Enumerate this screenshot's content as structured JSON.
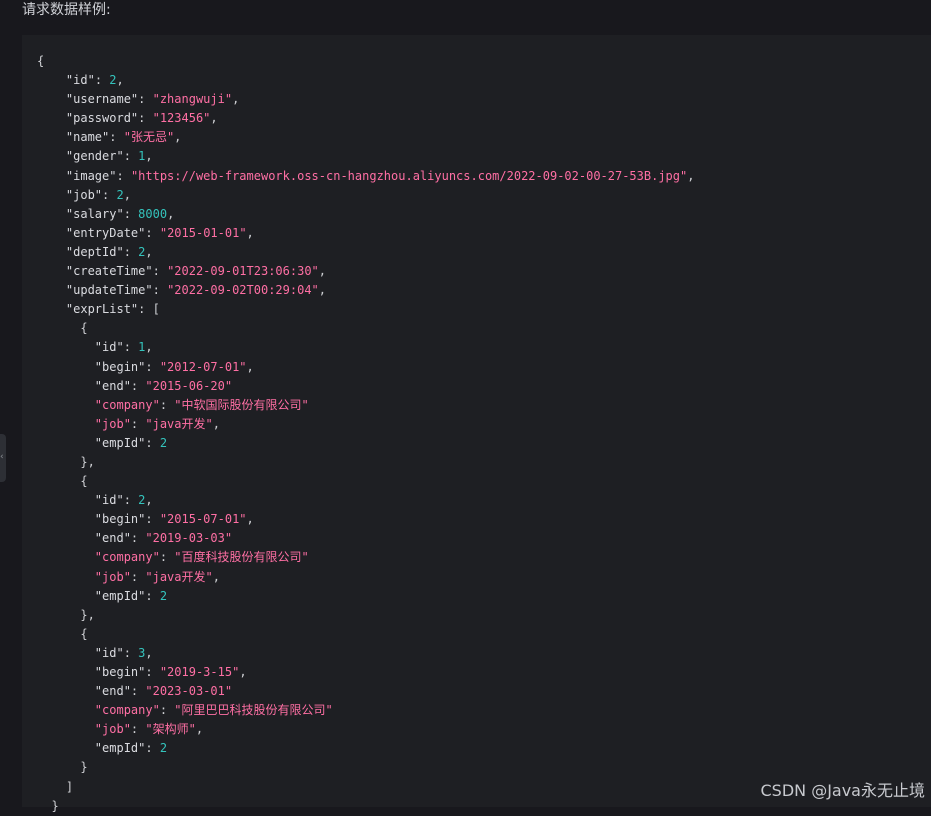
{
  "heading": "请求数据样例:",
  "watermark": "CSDN @Java永无止境",
  "code": [
    [
      {
        "t": "p",
        "v": "{"
      }
    ],
    [
      {
        "t": "p",
        "v": "    "
      },
      {
        "t": "k",
        "v": "\"id\""
      },
      {
        "t": "p",
        "v": ": "
      },
      {
        "t": "n",
        "v": "2"
      },
      {
        "t": "p",
        "v": ","
      }
    ],
    [
      {
        "t": "p",
        "v": "    "
      },
      {
        "t": "k",
        "v": "\"username\""
      },
      {
        "t": "p",
        "v": ": "
      },
      {
        "t": "s",
        "v": "\"zhangwuji\""
      },
      {
        "t": "p",
        "v": ","
      }
    ],
    [
      {
        "t": "p",
        "v": "    "
      },
      {
        "t": "k",
        "v": "\"password\""
      },
      {
        "t": "p",
        "v": ": "
      },
      {
        "t": "s",
        "v": "\"123456\""
      },
      {
        "t": "p",
        "v": ","
      }
    ],
    [
      {
        "t": "p",
        "v": "    "
      },
      {
        "t": "k",
        "v": "\"name\""
      },
      {
        "t": "p",
        "v": ": "
      },
      {
        "t": "s",
        "v": "\"张无忌\""
      },
      {
        "t": "p",
        "v": ","
      }
    ],
    [
      {
        "t": "p",
        "v": "    "
      },
      {
        "t": "k",
        "v": "\"gender\""
      },
      {
        "t": "p",
        "v": ": "
      },
      {
        "t": "n",
        "v": "1"
      },
      {
        "t": "p",
        "v": ","
      }
    ],
    [
      {
        "t": "p",
        "v": "    "
      },
      {
        "t": "k",
        "v": "\"image\""
      },
      {
        "t": "p",
        "v": ": "
      },
      {
        "t": "s",
        "v": "\"https://web-framework.oss-cn-hangzhou.aliyuncs.com/2022-09-02-00-27-53B.jpg\""
      },
      {
        "t": "p",
        "v": ","
      }
    ],
    [
      {
        "t": "p",
        "v": "    "
      },
      {
        "t": "k",
        "v": "\"job\""
      },
      {
        "t": "p",
        "v": ": "
      },
      {
        "t": "n",
        "v": "2"
      },
      {
        "t": "p",
        "v": ","
      }
    ],
    [
      {
        "t": "p",
        "v": "    "
      },
      {
        "t": "k",
        "v": "\"salary\""
      },
      {
        "t": "p",
        "v": ": "
      },
      {
        "t": "n",
        "v": "8000"
      },
      {
        "t": "p",
        "v": ","
      }
    ],
    [
      {
        "t": "p",
        "v": "    "
      },
      {
        "t": "k",
        "v": "\"entryDate\""
      },
      {
        "t": "p",
        "v": ": "
      },
      {
        "t": "s",
        "v": "\"2015-01-01\""
      },
      {
        "t": "p",
        "v": ","
      }
    ],
    [
      {
        "t": "p",
        "v": "    "
      },
      {
        "t": "k",
        "v": "\"deptId\""
      },
      {
        "t": "p",
        "v": ": "
      },
      {
        "t": "n",
        "v": "2"
      },
      {
        "t": "p",
        "v": ","
      }
    ],
    [
      {
        "t": "p",
        "v": "    "
      },
      {
        "t": "k",
        "v": "\"createTime\""
      },
      {
        "t": "p",
        "v": ": "
      },
      {
        "t": "s",
        "v": "\"2022-09-01T23:06:30\""
      },
      {
        "t": "p",
        "v": ","
      }
    ],
    [
      {
        "t": "p",
        "v": "    "
      },
      {
        "t": "k",
        "v": "\"updateTime\""
      },
      {
        "t": "p",
        "v": ": "
      },
      {
        "t": "s",
        "v": "\"2022-09-02T00:29:04\""
      },
      {
        "t": "p",
        "v": ","
      }
    ],
    [
      {
        "t": "p",
        "v": "    "
      },
      {
        "t": "k",
        "v": "\"exprList\""
      },
      {
        "t": "p",
        "v": ": ["
      }
    ],
    [
      {
        "t": "p",
        "v": "      {"
      }
    ],
    [
      {
        "t": "p",
        "v": "        "
      },
      {
        "t": "k",
        "v": "\"id\""
      },
      {
        "t": "p",
        "v": ": "
      },
      {
        "t": "n",
        "v": "1"
      },
      {
        "t": "p",
        "v": ","
      }
    ],
    [
      {
        "t": "p",
        "v": "        "
      },
      {
        "t": "k",
        "v": "\"begin\""
      },
      {
        "t": "p",
        "v": ": "
      },
      {
        "t": "s",
        "v": "\"2012-07-01\""
      },
      {
        "t": "p",
        "v": ","
      }
    ],
    [
      {
        "t": "p",
        "v": "        "
      },
      {
        "t": "k",
        "v": "\"end\""
      },
      {
        "t": "p",
        "v": ": "
      },
      {
        "t": "s",
        "v": "\"2015-06-20\""
      }
    ],
    [
      {
        "t": "p",
        "v": "        "
      },
      {
        "t": "s",
        "v": "\"company\""
      },
      {
        "t": "p",
        "v": ": "
      },
      {
        "t": "s",
        "v": "\"中软国际股份有限公司\""
      }
    ],
    [
      {
        "t": "p",
        "v": "        "
      },
      {
        "t": "s",
        "v": "\"job\""
      },
      {
        "t": "p",
        "v": ": "
      },
      {
        "t": "s",
        "v": "\"java开发\""
      },
      {
        "t": "p",
        "v": ","
      }
    ],
    [
      {
        "t": "p",
        "v": "        "
      },
      {
        "t": "k",
        "v": "\"empId\""
      },
      {
        "t": "p",
        "v": ": "
      },
      {
        "t": "n",
        "v": "2"
      }
    ],
    [
      {
        "t": "p",
        "v": "      },"
      }
    ],
    [
      {
        "t": "p",
        "v": "      {"
      }
    ],
    [
      {
        "t": "p",
        "v": "        "
      },
      {
        "t": "k",
        "v": "\"id\""
      },
      {
        "t": "p",
        "v": ": "
      },
      {
        "t": "n",
        "v": "2"
      },
      {
        "t": "p",
        "v": ","
      }
    ],
    [
      {
        "t": "p",
        "v": "        "
      },
      {
        "t": "k",
        "v": "\"begin\""
      },
      {
        "t": "p",
        "v": ": "
      },
      {
        "t": "s",
        "v": "\"2015-07-01\""
      },
      {
        "t": "p",
        "v": ","
      }
    ],
    [
      {
        "t": "p",
        "v": "        "
      },
      {
        "t": "k",
        "v": "\"end\""
      },
      {
        "t": "p",
        "v": ": "
      },
      {
        "t": "s",
        "v": "\"2019-03-03\""
      }
    ],
    [
      {
        "t": "p",
        "v": "        "
      },
      {
        "t": "s",
        "v": "\"company\""
      },
      {
        "t": "p",
        "v": ": "
      },
      {
        "t": "s",
        "v": "\"百度科技股份有限公司\""
      }
    ],
    [
      {
        "t": "p",
        "v": "        "
      },
      {
        "t": "s",
        "v": "\"job\""
      },
      {
        "t": "p",
        "v": ": "
      },
      {
        "t": "s",
        "v": "\"java开发\""
      },
      {
        "t": "p",
        "v": ","
      }
    ],
    [
      {
        "t": "p",
        "v": "        "
      },
      {
        "t": "k",
        "v": "\"empId\""
      },
      {
        "t": "p",
        "v": ": "
      },
      {
        "t": "n",
        "v": "2"
      }
    ],
    [
      {
        "t": "p",
        "v": "      },"
      }
    ],
    [
      {
        "t": "p",
        "v": "      {"
      }
    ],
    [
      {
        "t": "p",
        "v": "        "
      },
      {
        "t": "k",
        "v": "\"id\""
      },
      {
        "t": "p",
        "v": ": "
      },
      {
        "t": "n",
        "v": "3"
      },
      {
        "t": "p",
        "v": ","
      }
    ],
    [
      {
        "t": "p",
        "v": "        "
      },
      {
        "t": "k",
        "v": "\"begin\""
      },
      {
        "t": "p",
        "v": ": "
      },
      {
        "t": "s",
        "v": "\"2019-3-15\""
      },
      {
        "t": "p",
        "v": ","
      }
    ],
    [
      {
        "t": "p",
        "v": "        "
      },
      {
        "t": "k",
        "v": "\"end\""
      },
      {
        "t": "p",
        "v": ": "
      },
      {
        "t": "s",
        "v": "\"2023-03-01\""
      }
    ],
    [
      {
        "t": "p",
        "v": "        "
      },
      {
        "t": "s",
        "v": "\"company\""
      },
      {
        "t": "p",
        "v": ": "
      },
      {
        "t": "s",
        "v": "\"阿里巴巴科技股份有限公司\""
      }
    ],
    [
      {
        "t": "p",
        "v": "        "
      },
      {
        "t": "s",
        "v": "\"job\""
      },
      {
        "t": "p",
        "v": ": "
      },
      {
        "t": "s",
        "v": "\"架构师\""
      },
      {
        "t": "p",
        "v": ","
      }
    ],
    [
      {
        "t": "p",
        "v": "        "
      },
      {
        "t": "k",
        "v": "\"empId\""
      },
      {
        "t": "p",
        "v": ": "
      },
      {
        "t": "n",
        "v": "2"
      }
    ],
    [
      {
        "t": "p",
        "v": "      }"
      }
    ],
    [
      {
        "t": "p",
        "v": "    ]"
      }
    ],
    [
      {
        "t": "p",
        "v": "  }"
      }
    ]
  ]
}
